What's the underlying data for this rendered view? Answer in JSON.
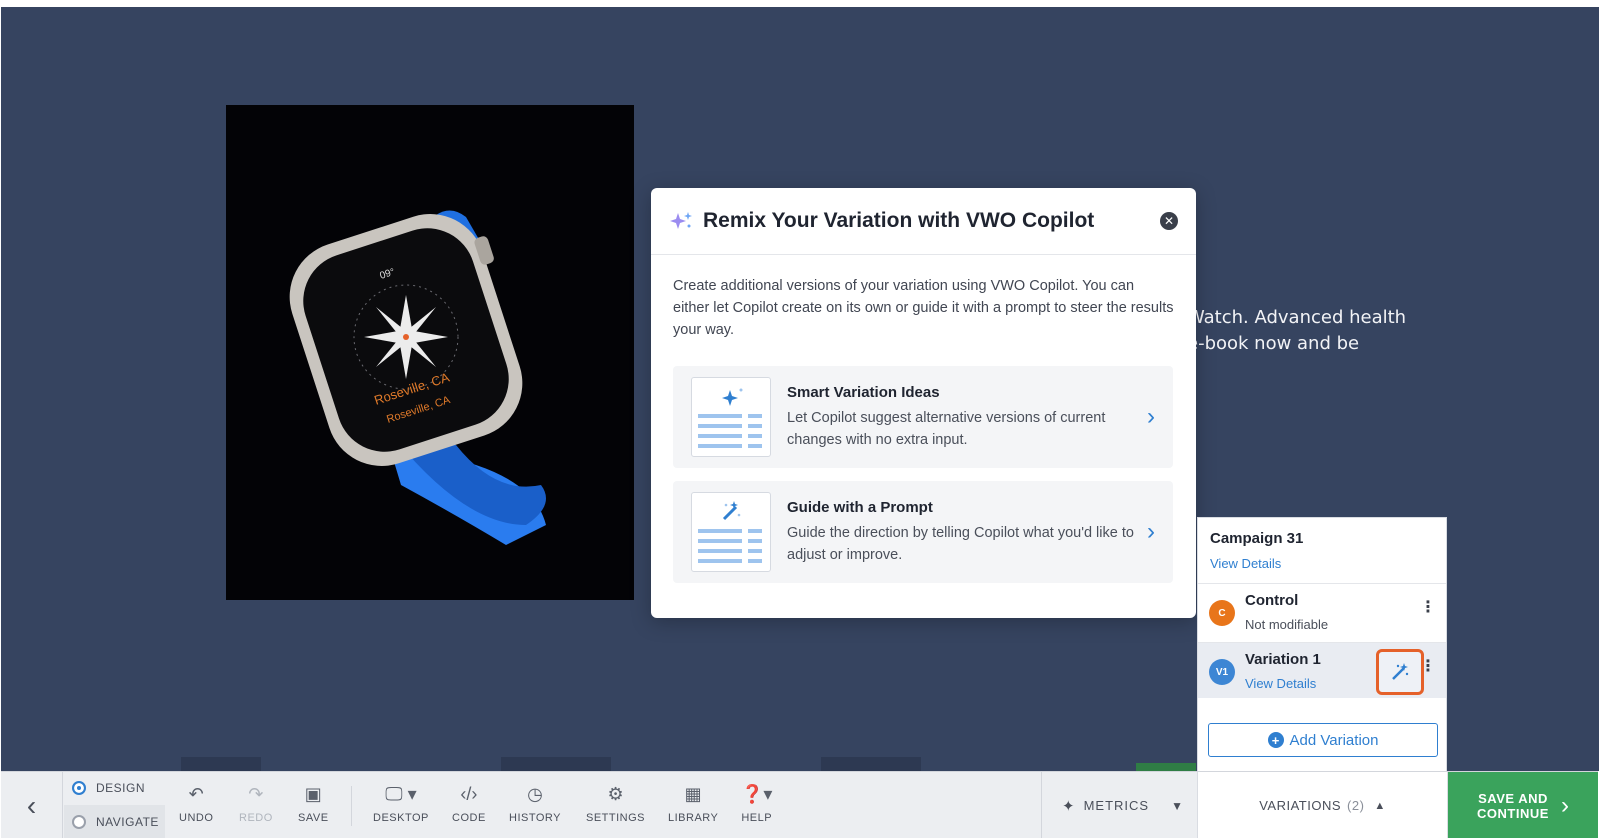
{
  "page": {
    "body_text_line1": "Watch. Advanced health",
    "body_text_line2": "e-book now and be"
  },
  "modal": {
    "title": "Remix Your Variation with VWO Copilot",
    "description": "Create additional versions of your variation using VWO Copilot. You can either let Copilot create on its own or guide it with a prompt to steer the results your way.",
    "options": [
      {
        "title": "Smart Variation Ideas",
        "text": "Let Copilot suggest alternative versions of current changes with no extra input."
      },
      {
        "title": "Guide with a Prompt",
        "text": "Guide the direction by telling Copilot what you'd like to adjust or improve."
      }
    ]
  },
  "watch": {
    "temp": "09°",
    "city1": "Roseville, CA",
    "city2": "Roseville, CA"
  },
  "variations_panel": {
    "campaign_name": "Campaign 31",
    "view_details": "View Details",
    "rows": [
      {
        "badge": "C",
        "name": "Control",
        "sub": "Not modifiable",
        "color": "#e8751a"
      },
      {
        "badge": "V1",
        "name": "Variation 1",
        "sub": "View Details",
        "color": "#3d86d4"
      }
    ],
    "add_variation": "Add Variation"
  },
  "toolbar": {
    "design": "DESIGN",
    "navigate": "NAVIGATE",
    "undo": "UNDO",
    "redo": "REDO",
    "save": "SAVE",
    "desktop": "DESKTOP",
    "code": "CODE",
    "history": "HISTORY",
    "settings": "SETTINGS",
    "library": "LIBRARY",
    "help": "HELP",
    "metrics": "METRICS",
    "variations": "VARIATIONS",
    "variations_count": "(2)",
    "save_line1": "SAVE AND",
    "save_line2": "CONTINUE"
  },
  "colors": {
    "canvas_bg": "#364460",
    "accent_blue": "#2f7fd0",
    "highlight_orange": "#e5612a",
    "save_green": "#3aa35c"
  }
}
